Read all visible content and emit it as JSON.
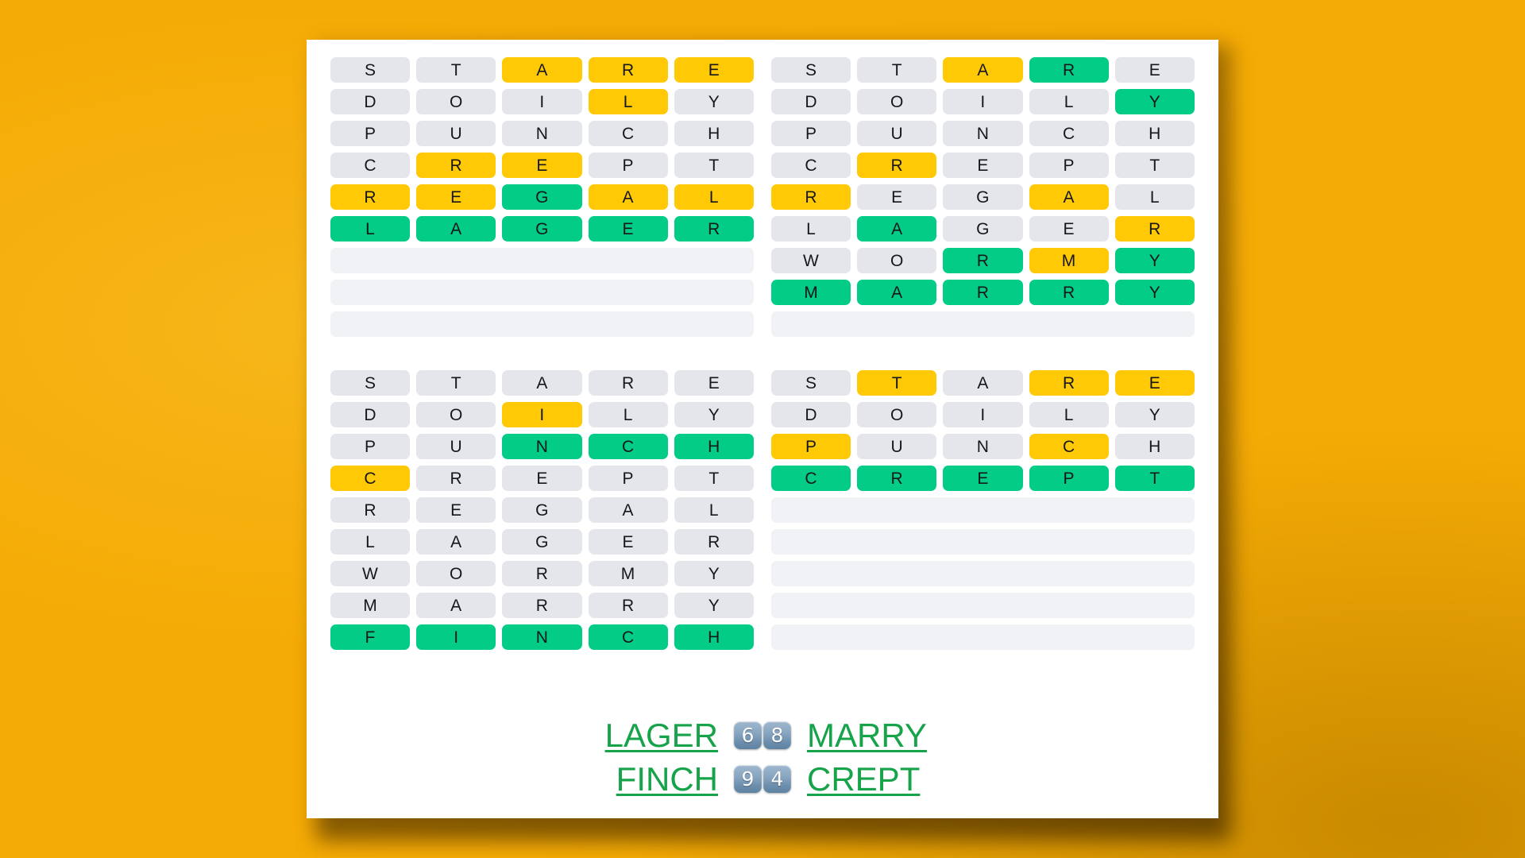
{
  "theme": {
    "page_background": "#F5AB05",
    "card_background": "#FFFFFF",
    "tile_gray": "#E4E6EB",
    "tile_yellow": "#FFC905",
    "tile_green": "#03CC87",
    "empty_row": "#F1F2F6",
    "answer_green": "#17A34A",
    "score_box_blue": "#6E90AE"
  },
  "grids": [
    {
      "name": "quordle-grid-1",
      "answer": "LAGER",
      "rows": [
        {
          "letters": [
            "S",
            "T",
            "A",
            "R",
            "E"
          ],
          "states": [
            "gray",
            "gray",
            "yellow",
            "yellow",
            "yellow"
          ]
        },
        {
          "letters": [
            "D",
            "O",
            "I",
            "L",
            "Y"
          ],
          "states": [
            "gray",
            "gray",
            "gray",
            "yellow",
            "gray"
          ]
        },
        {
          "letters": [
            "P",
            "U",
            "N",
            "C",
            "H"
          ],
          "states": [
            "gray",
            "gray",
            "gray",
            "gray",
            "gray"
          ]
        },
        {
          "letters": [
            "C",
            "R",
            "E",
            "P",
            "T"
          ],
          "states": [
            "gray",
            "yellow",
            "yellow",
            "gray",
            "gray"
          ]
        },
        {
          "letters": [
            "R",
            "E",
            "G",
            "A",
            "L"
          ],
          "states": [
            "yellow",
            "yellow",
            "green",
            "yellow",
            "yellow"
          ]
        },
        {
          "letters": [
            "L",
            "A",
            "G",
            "E",
            "R"
          ],
          "states": [
            "green",
            "green",
            "green",
            "green",
            "green"
          ]
        },
        {
          "letters": [],
          "states": []
        },
        {
          "letters": [],
          "states": []
        },
        {
          "letters": [],
          "states": []
        }
      ]
    },
    {
      "name": "quordle-grid-2",
      "answer": "MARRY",
      "rows": [
        {
          "letters": [
            "S",
            "T",
            "A",
            "R",
            "E"
          ],
          "states": [
            "gray",
            "gray",
            "yellow",
            "green",
            "gray"
          ]
        },
        {
          "letters": [
            "D",
            "O",
            "I",
            "L",
            "Y"
          ],
          "states": [
            "gray",
            "gray",
            "gray",
            "gray",
            "green"
          ]
        },
        {
          "letters": [
            "P",
            "U",
            "N",
            "C",
            "H"
          ],
          "states": [
            "gray",
            "gray",
            "gray",
            "gray",
            "gray"
          ]
        },
        {
          "letters": [
            "C",
            "R",
            "E",
            "P",
            "T"
          ],
          "states": [
            "gray",
            "yellow",
            "gray",
            "gray",
            "gray"
          ]
        },
        {
          "letters": [
            "R",
            "E",
            "G",
            "A",
            "L"
          ],
          "states": [
            "yellow",
            "gray",
            "gray",
            "yellow",
            "gray"
          ]
        },
        {
          "letters": [
            "L",
            "A",
            "G",
            "E",
            "R"
          ],
          "states": [
            "gray",
            "green",
            "gray",
            "gray",
            "yellow"
          ]
        },
        {
          "letters": [
            "W",
            "O",
            "R",
            "M",
            "Y"
          ],
          "states": [
            "gray",
            "gray",
            "green",
            "yellow",
            "green"
          ]
        },
        {
          "letters": [
            "M",
            "A",
            "R",
            "R",
            "Y"
          ],
          "states": [
            "green",
            "green",
            "green",
            "green",
            "green"
          ]
        },
        {
          "letters": [],
          "states": []
        }
      ]
    },
    {
      "name": "quordle-grid-3",
      "answer": "FINCH",
      "rows": [
        {
          "letters": [
            "S",
            "T",
            "A",
            "R",
            "E"
          ],
          "states": [
            "gray",
            "gray",
            "gray",
            "gray",
            "gray"
          ]
        },
        {
          "letters": [
            "D",
            "O",
            "I",
            "L",
            "Y"
          ],
          "states": [
            "gray",
            "gray",
            "yellow",
            "gray",
            "gray"
          ]
        },
        {
          "letters": [
            "P",
            "U",
            "N",
            "C",
            "H"
          ],
          "states": [
            "gray",
            "gray",
            "green",
            "green",
            "green"
          ]
        },
        {
          "letters": [
            "C",
            "R",
            "E",
            "P",
            "T"
          ],
          "states": [
            "yellow",
            "gray",
            "gray",
            "gray",
            "gray"
          ]
        },
        {
          "letters": [
            "R",
            "E",
            "G",
            "A",
            "L"
          ],
          "states": [
            "gray",
            "gray",
            "gray",
            "gray",
            "gray"
          ]
        },
        {
          "letters": [
            "L",
            "A",
            "G",
            "E",
            "R"
          ],
          "states": [
            "gray",
            "gray",
            "gray",
            "gray",
            "gray"
          ]
        },
        {
          "letters": [
            "W",
            "O",
            "R",
            "M",
            "Y"
          ],
          "states": [
            "gray",
            "gray",
            "gray",
            "gray",
            "gray"
          ]
        },
        {
          "letters": [
            "M",
            "A",
            "R",
            "R",
            "Y"
          ],
          "states": [
            "gray",
            "gray",
            "gray",
            "gray",
            "gray"
          ]
        },
        {
          "letters": [
            "F",
            "I",
            "N",
            "C",
            "H"
          ],
          "states": [
            "green",
            "green",
            "green",
            "green",
            "green"
          ]
        }
      ]
    },
    {
      "name": "quordle-grid-4",
      "answer": "CREPT",
      "rows": [
        {
          "letters": [
            "S",
            "T",
            "A",
            "R",
            "E"
          ],
          "states": [
            "gray",
            "yellow",
            "gray",
            "yellow",
            "yellow"
          ]
        },
        {
          "letters": [
            "D",
            "O",
            "I",
            "L",
            "Y"
          ],
          "states": [
            "gray",
            "gray",
            "gray",
            "gray",
            "gray"
          ]
        },
        {
          "letters": [
            "P",
            "U",
            "N",
            "C",
            "H"
          ],
          "states": [
            "yellow",
            "gray",
            "gray",
            "yellow",
            "gray"
          ]
        },
        {
          "letters": [
            "C",
            "R",
            "E",
            "P",
            "T"
          ],
          "states": [
            "green",
            "green",
            "green",
            "green",
            "green"
          ]
        },
        {
          "letters": [],
          "states": []
        },
        {
          "letters": [],
          "states": []
        },
        {
          "letters": [],
          "states": []
        },
        {
          "letters": [],
          "states": []
        },
        {
          "letters": [],
          "states": []
        }
      ]
    }
  ],
  "footer": {
    "lines": [
      {
        "left_word": "LAGER",
        "left_score": "6",
        "right_score": "8",
        "right_word": "MARRY"
      },
      {
        "left_word": "FINCH",
        "left_score": "9",
        "right_score": "4",
        "right_word": "CREPT"
      }
    ]
  }
}
